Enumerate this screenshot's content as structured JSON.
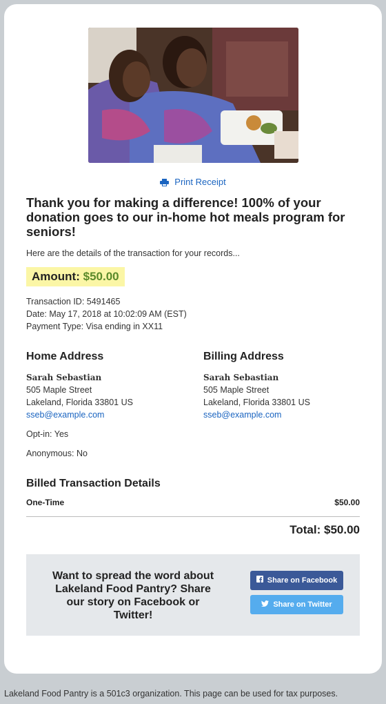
{
  "print_label": "Print Receipt",
  "thanks": "Thank you for making a difference! 100% of your donation goes to our in-home hot meals program for seniors!",
  "intro": "Here are the details of the transaction for your records...",
  "amount": {
    "label": "Amount:",
    "value": "$50.00"
  },
  "transaction": {
    "id_line": "Transaction ID: 5491465",
    "date_line": "Date: May 17, 2018 at 10:02:09 AM (EST)",
    "payment_line": "Payment Type: Visa ending in XX11"
  },
  "home_address": {
    "heading": "Home Address",
    "name": "Sarah Sebastian",
    "street": "505 Maple Street",
    "city": "Lakeland, Florida 33801 US",
    "email": "sseb@example.com"
  },
  "billing_address": {
    "heading": "Billing Address",
    "name": "Sarah Sebastian",
    "street": "505 Maple Street",
    "city": "Lakeland, Florida 33801 US",
    "email": "sseb@example.com"
  },
  "optin": "Opt-in: Yes",
  "anonymous": "Anonymous: No",
  "billed": {
    "heading": "Billed Transaction Details",
    "item_label": "One-Time",
    "item_amount": "$50.00",
    "total": "Total: $50.00"
  },
  "share": {
    "message": "Want to spread the word about Lakeland Food Pantry? Share our story on Facebook or Twitter!",
    "facebook_label": "Share on Facebook",
    "twitter_label": "Share on Twitter",
    "facebook_color": "#3b5998",
    "twitter_color": "#55acee"
  },
  "footer": "Lakeland Food Pantry is a 501c3 organization. This page can be used for tax purposes."
}
